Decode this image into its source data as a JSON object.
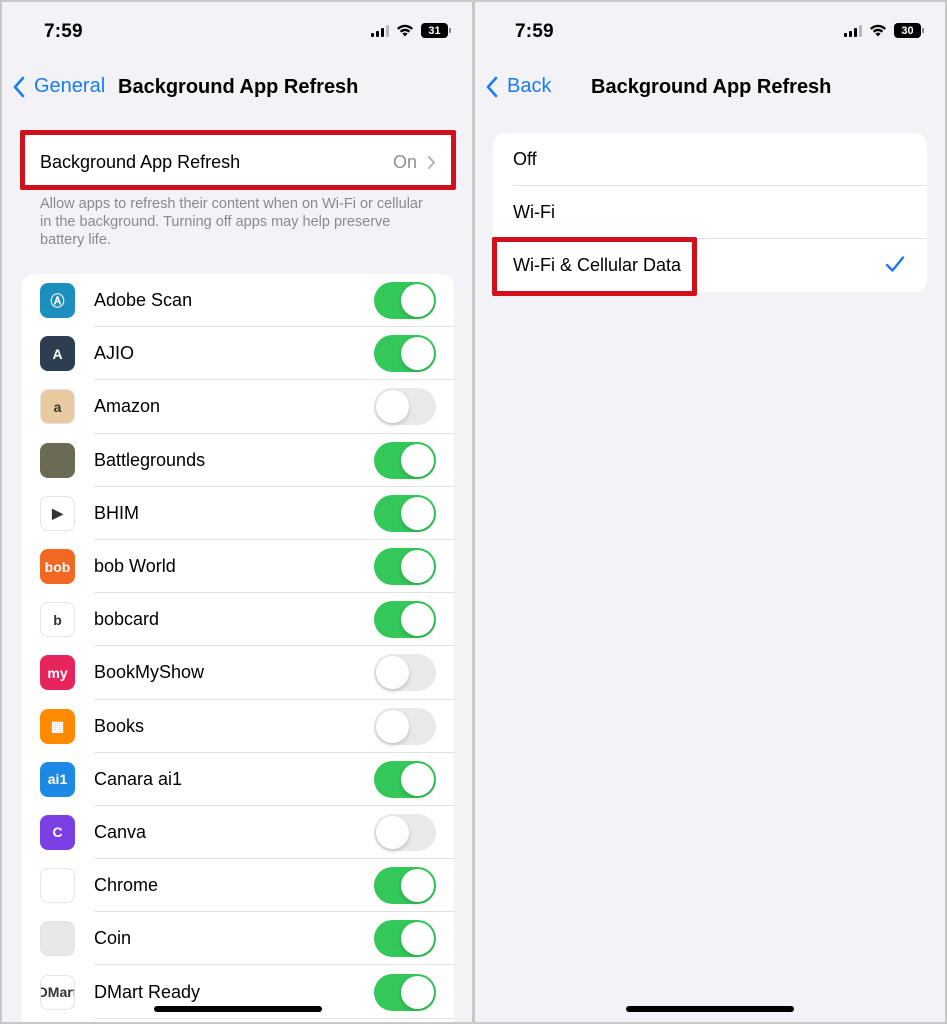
{
  "left": {
    "status": {
      "time": "7:59",
      "battery": "31"
    },
    "nav": {
      "back_label": "General",
      "title": "Background App Refresh"
    },
    "setting": {
      "label": "Background App Refresh",
      "value": "On"
    },
    "footnote": "Allow apps to refresh their content when on Wi-Fi or cellular in the background. Turning off apps may help preserve battery life.",
    "apps": [
      {
        "name": "Adobe Scan",
        "on": true,
        "icon_color": "#1d8fbf",
        "glyph": "Ⓐ"
      },
      {
        "name": "AJIO",
        "on": true,
        "icon_color": "#2c3e50",
        "glyph": "A"
      },
      {
        "name": "Amazon",
        "on": false,
        "icon_color": "#e8c9a0",
        "glyph": "a"
      },
      {
        "name": "Battlegrounds",
        "on": true,
        "icon_color": "#6b6a55",
        "glyph": ""
      },
      {
        "name": "BHIM",
        "on": true,
        "icon_color": "#ffffff",
        "glyph": "▶"
      },
      {
        "name": "bob World",
        "on": true,
        "icon_color": "#f26722",
        "glyph": "bob"
      },
      {
        "name": "bobcard",
        "on": true,
        "icon_color": "#ffffff",
        "glyph": "b"
      },
      {
        "name": "BookMyShow",
        "on": false,
        "icon_color": "#e8245d",
        "glyph": "my"
      },
      {
        "name": "Books",
        "on": false,
        "icon_color": "#ff8a00",
        "glyph": "▦"
      },
      {
        "name": "Canara ai1",
        "on": true,
        "icon_color": "#1e88e5",
        "glyph": "ai1"
      },
      {
        "name": "Canva",
        "on": false,
        "icon_color": "#7b3fe4",
        "glyph": "C"
      },
      {
        "name": "Chrome",
        "on": true,
        "icon_color": "#ffffff",
        "glyph": ""
      },
      {
        "name": "Coin",
        "on": true,
        "icon_color": "#e8e8e8",
        "glyph": ""
      },
      {
        "name": "DMart  Ready",
        "on": true,
        "icon_color": "#ffffff",
        "glyph": "DMart"
      }
    ]
  },
  "right": {
    "status": {
      "time": "7:59",
      "battery": "30"
    },
    "nav": {
      "back_label": "Back",
      "title": "Background App Refresh"
    },
    "options": [
      {
        "label": "Off",
        "selected": false
      },
      {
        "label": "Wi-Fi",
        "selected": false
      },
      {
        "label": "Wi-Fi & Cellular Data",
        "selected": true
      }
    ]
  },
  "colors": {
    "accent": "#1a7cf4",
    "toggle_on": "#34c759",
    "highlight": "#d0101a"
  }
}
